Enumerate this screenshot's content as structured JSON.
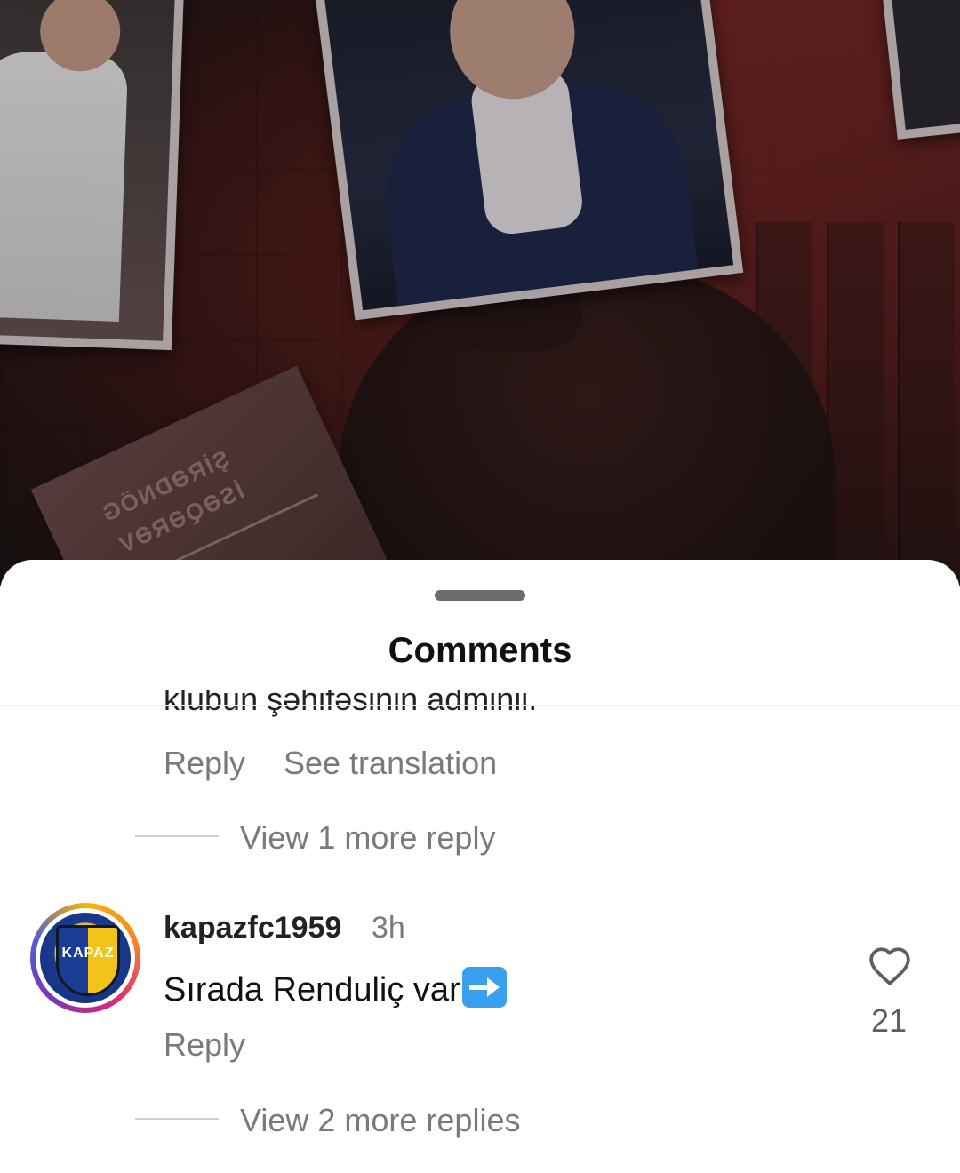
{
  "sheet": {
    "title": "Comments"
  },
  "previous_comment": {
    "cut_text": "klubun şəhifəsinin adminii.",
    "reply_label": "Reply",
    "translate_label": "See translation",
    "view_replies": "View 1 more reply"
  },
  "comment": {
    "username": "kapazfc1959",
    "time": "3h",
    "text": "Sırada Renduliç var",
    "emoji_icon": "right-arrow-emoji",
    "reply_label": "Reply",
    "like_count": "21",
    "like_icon": "heart-outline-icon",
    "view_replies": "View 2 more replies"
  },
  "post_image": {
    "poster_text_line1": "ŞİRƏDNÖG",
    "poster_text_line2": "İSƏQƏRƏV"
  }
}
